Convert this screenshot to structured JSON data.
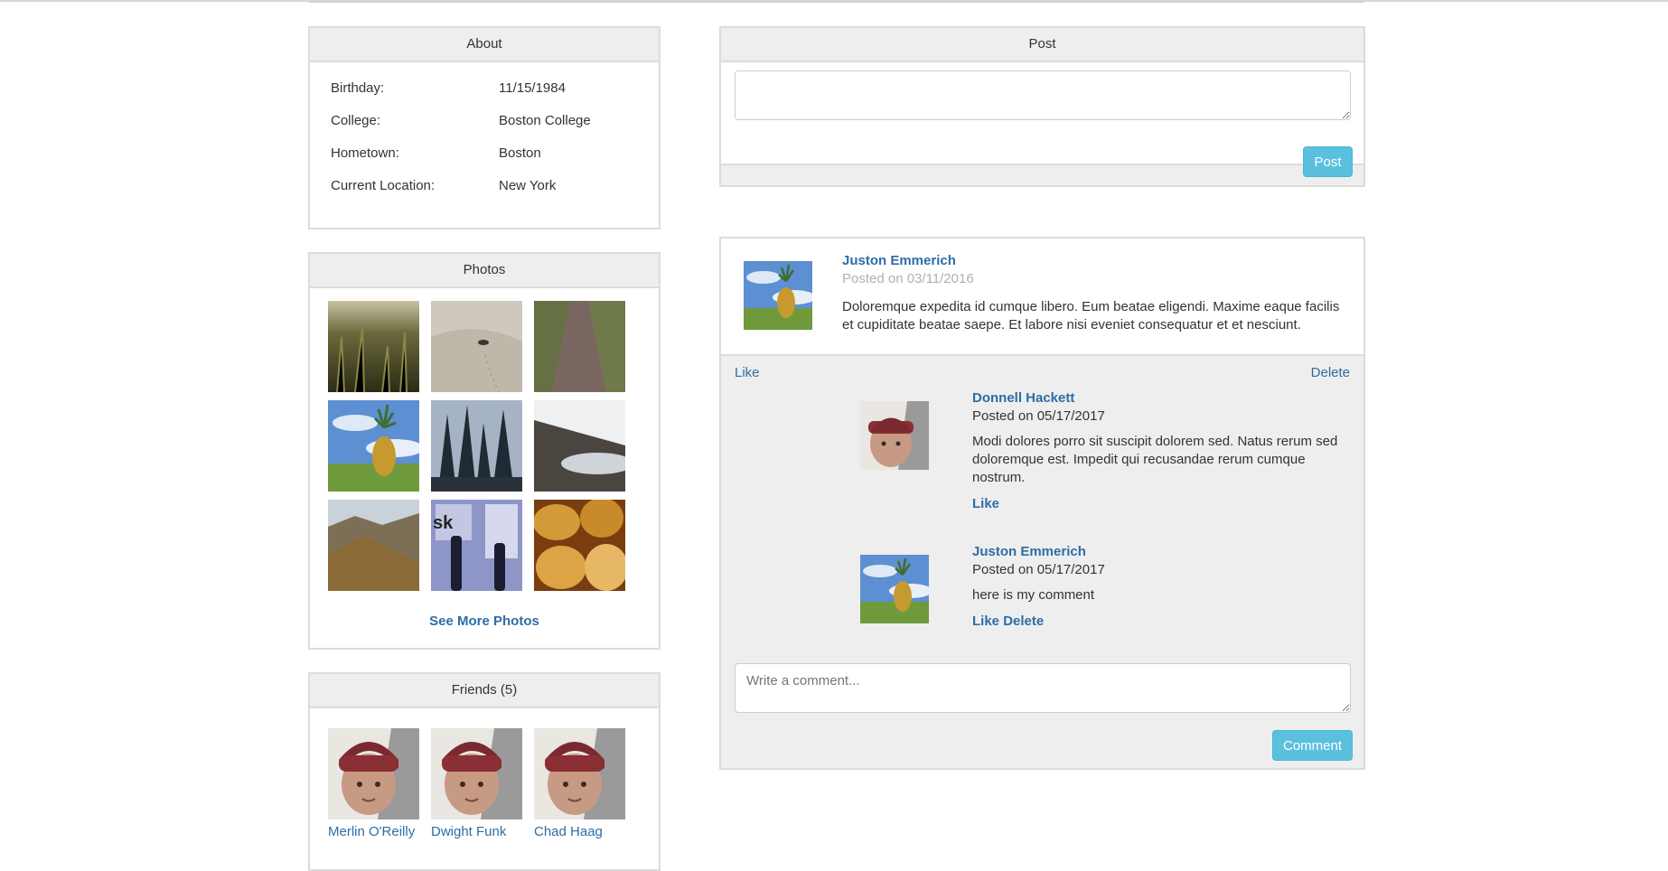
{
  "about": {
    "title": "About",
    "rows": [
      {
        "label": "Birthday:",
        "value": "11/15/1984"
      },
      {
        "label": "College:",
        "value": "Boston College"
      },
      {
        "label": "Hometown:",
        "value": "Boston"
      },
      {
        "label": "Current Location:",
        "value": "New York"
      }
    ]
  },
  "photos": {
    "title": "Photos",
    "see_more": "See More Photos"
  },
  "friends": {
    "title": "Friends (5)",
    "items": [
      {
        "name": "Merlin O'Reilly"
      },
      {
        "name": "Dwight Funk"
      },
      {
        "name": "Chad Haag"
      }
    ]
  },
  "composer": {
    "title": "Post",
    "value": "",
    "button": "Post"
  },
  "feed_post": {
    "author": "Juston Emmerich",
    "date": "Posted on 03/11/2016",
    "text": "Doloremque expedita id cumque libero. Eum beatae eligendi. Maxime eaque facilis et cupiditate beatae saepe. Et labore nisi eveniet consequatur et et nesciunt.",
    "like": "Like",
    "delete": "Delete",
    "comments": [
      {
        "author": "Donnell Hackett",
        "date": "Posted on 05/17/2017",
        "text": "Modi dolores porro sit suscipit dolorem sed. Natus rerum sed doloremque est. Impedit qui recusandae rerum cumque nostrum.",
        "like": "Like"
      },
      {
        "author": "Juston Emmerich",
        "date": "Posted on 05/17/2017",
        "text": "here is my comment",
        "like": "Like",
        "delete": "Delete"
      }
    ],
    "comment_placeholder": "Write a comment...",
    "comment_button": "Comment"
  },
  "colors": {
    "link": "#2e6da4",
    "button": "#5bc0de",
    "panel_head": "#eeeeee",
    "border": "#dcdcdc"
  }
}
